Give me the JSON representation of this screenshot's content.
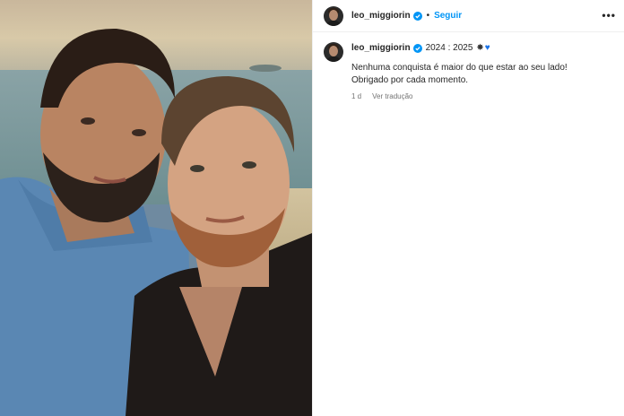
{
  "post": {
    "photo_alt": "",
    "header": {
      "username": "leo_miggiorin",
      "dot": "•",
      "follow_label": "Seguir",
      "more_label": "•••"
    },
    "caption": {
      "username": "leo_miggiorin",
      "title": "2024 : 2025",
      "star_emoji": "✸",
      "heart_emoji": "♥",
      "text": "Nenhuma conquista é maior do que estar ao seu lado! Obrigado por cada momento.",
      "time_ago": "1 d",
      "translate_label": "Ver tradução"
    },
    "colors": {
      "verified": "#0095f6",
      "link": "#0095f6",
      "heart": "#1a73e8"
    },
    "icons": [
      "verified-badge-icon",
      "more-options-icon",
      "heart-emoji",
      "star-emoji"
    ]
  }
}
